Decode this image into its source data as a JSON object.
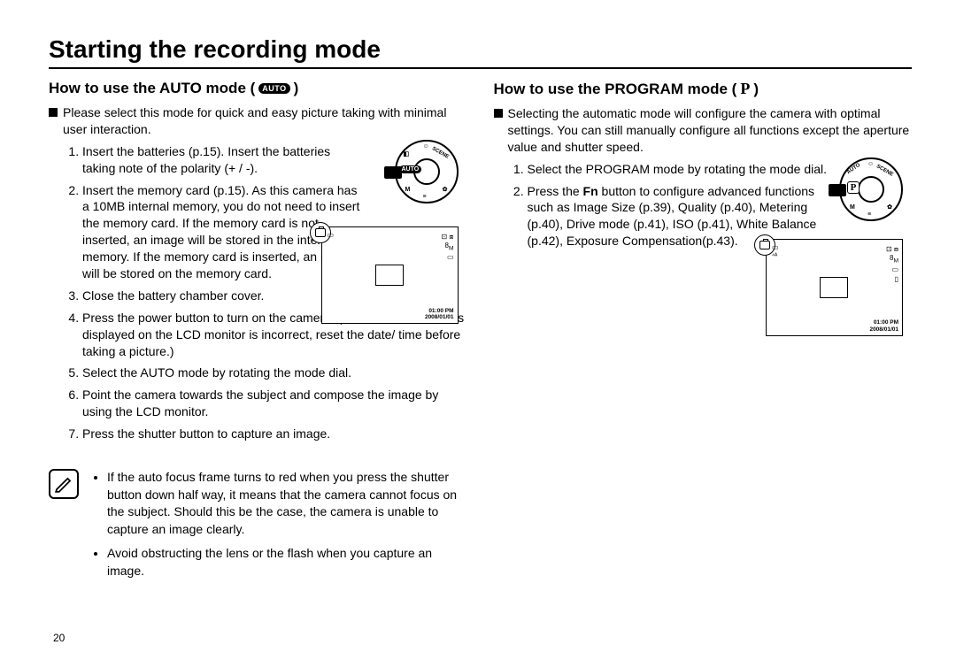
{
  "page": {
    "title": "Starting the recording mode",
    "number": "20"
  },
  "auto": {
    "heading_prefix": "How to use the AUTO mode (",
    "heading_badge": "AUTO",
    "heading_suffix": ")",
    "intro": "Please select this mode for quick and easy picture taking with minimal user interaction.",
    "steps": [
      "Insert the batteries (p.15). Insert the batteries taking note of the polarity (+ / -).",
      "Insert the memory card (p.15). As this camera has a 10MB internal memory, you do not need to insert the memory card. If the memory card is not inserted, an image will be stored in the internal memory. If the memory card is inserted, an image will be stored on the memory card.",
      "Close the battery chamber cover.",
      "Press the power button to turn on the camera. (If the date/ time that is displayed on the LCD monitor is incorrect, reset the date/ time before taking a picture.)",
      "Select the AUTO mode by rotating the mode dial.",
      "Point the camera towards the subject and compose the image by using the LCD monitor.",
      "Press the shutter button to capture an image."
    ],
    "notes": [
      "If the auto focus frame turns to red when you press the shutter button down half way, it means that the camera cannot focus on the subject. Should this be the case, the camera is unable to capture an image clearly.",
      "Avoid obstructing the lens or the flash when you capture an image."
    ],
    "dial_label": "AUTO",
    "lcd": {
      "time": "01:00 PM",
      "date": "2008/01/01"
    }
  },
  "program": {
    "heading_prefix": "How to use the PROGRAM mode (",
    "heading_badge": "P",
    "heading_suffix": ")",
    "intro": "Selecting the automatic mode will configure the camera with optimal settings. You can still manually configure all functions except the aperture value and shutter speed.",
    "steps": [
      "Select the PROGRAM mode by rotating the mode dial.",
      "Press the Fn button to configure advanced functions such as Image Size (p.39), Quality (p.40), Metering (p.40), Drive mode (p.41), ISO (p.41), White Balance (p.42), Exposure Compensation(p.43)."
    ],
    "step2_parts": {
      "a": "Press the ",
      "b": "Fn",
      "c": " button to configure advanced functions such as Image Size (p.39), Quality (p.40), Metering (p.40), Drive mode (p.41), ISO (p.41), White Balance (p.42), Exposure Compensation(p.43)."
    },
    "dial_label": "P",
    "lcd": {
      "time": "01:00 PM",
      "date": "2008/01/01"
    }
  }
}
